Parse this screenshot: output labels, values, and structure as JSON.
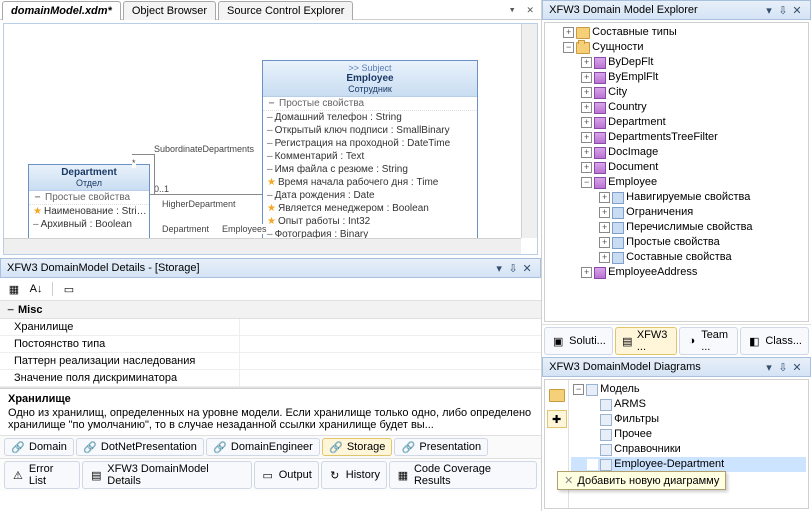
{
  "top_tabs": {
    "items": [
      {
        "label": "domainModel.xdm*",
        "active": true
      },
      {
        "label": "Object Browser",
        "active": false
      },
      {
        "label": "Source Control Explorer",
        "active": false
      }
    ]
  },
  "diagram": {
    "entities": {
      "department": {
        "title": "Department",
        "alt": "Отдел",
        "section": "Простые свойства",
        "rows": [
          {
            "star": true,
            "text": "Наименование : Stri…"
          },
          {
            "star": false,
            "text": "Архивный : Boolean"
          }
        ]
      },
      "employee": {
        "kind": ">> Subject",
        "title": "Employee",
        "alt": "Сотрудник",
        "section": "Простые свойства",
        "rows": [
          {
            "star": false,
            "text": "Домашний телефон : String"
          },
          {
            "star": false,
            "text": "Открытый ключ подписи : SmallBinary"
          },
          {
            "star": false,
            "text": "Регистрация на проходной : DateTime"
          },
          {
            "star": false,
            "text": "Комментарий : Text"
          },
          {
            "star": false,
            "text": "Имя файла с резюме : String"
          },
          {
            "star": true,
            "text": "Время начала рабочего дня : Time"
          },
          {
            "star": false,
            "text": "Дата рождения : Date"
          },
          {
            "star": true,
            "text": "Является менеджером : Boolean"
          },
          {
            "star": true,
            "text": "Опыт работы : Int32"
          },
          {
            "star": false,
            "text": "Фотография : Binary"
          }
        ]
      }
    },
    "rel": {
      "subDep": "SubordinateDepartments",
      "star": "*",
      "higher": "HigherDepartment",
      "zeroOne": "0..1",
      "depRole": "Department",
      "empRole": "Employees"
    }
  },
  "details": {
    "title": "XFW3 DomainModel Details - [Storage]",
    "category": "Misc",
    "rows": [
      {
        "name": "Хранилище",
        "value": ""
      },
      {
        "name": "Постоянство типа",
        "value": ""
      },
      {
        "name": "Паттерн реализации наследования",
        "value": ""
      },
      {
        "name": "Значение поля дискриминатора",
        "value": ""
      }
    ],
    "desc_title": "Хранилище",
    "desc_body": "Одно из хранилищ, определенных на уровне модели. Если хранилище только одно, либо определено хранилище \"по умолчанию\", то в случае незаданной ссылки хранилище будет вы..."
  },
  "aspect_tabs": {
    "items": [
      {
        "label": "Domain"
      },
      {
        "label": "DotNetPresentation"
      },
      {
        "label": "DomainEngineer"
      },
      {
        "label": "Storage",
        "selected": true
      },
      {
        "label": "Presentation"
      }
    ]
  },
  "output_tabs": {
    "items": [
      {
        "label": "Error List"
      },
      {
        "label": "XFW3 DomainModel Details"
      },
      {
        "label": "Output"
      },
      {
        "label": "History"
      },
      {
        "label": "Code Coverage Results"
      }
    ]
  },
  "explorer": {
    "title": "XFW3 Domain Model Explorer",
    "root": {
      "composite": "Составные типы",
      "entities": "Сущности",
      "list": [
        "ByDepFlt",
        "ByEmplFlt",
        "City",
        "Country",
        "Department",
        "DepartmentsTreeFilter",
        "DocImage",
        "Document",
        "Employee",
        "EmployeeAddress"
      ],
      "emp_children": [
        "Навигируемые свойства",
        "Ограничения",
        "Перечислимые свойства",
        "Простые свойства",
        "Составные свойства"
      ]
    }
  },
  "mid_tabs": {
    "items": [
      {
        "label": "Soluti..."
      },
      {
        "label": "XFW3 ...",
        "selected": true
      },
      {
        "label": "Team ..."
      },
      {
        "label": "Class..."
      }
    ]
  },
  "diagrams": {
    "title": "XFW3 DomainModel Diagrams",
    "root": "Модель",
    "items": [
      "ARMS",
      "Фильтры",
      "Прочее",
      "Справочники",
      "Employee-Department"
    ],
    "tooltip": "Добавить новую диаграмму"
  }
}
